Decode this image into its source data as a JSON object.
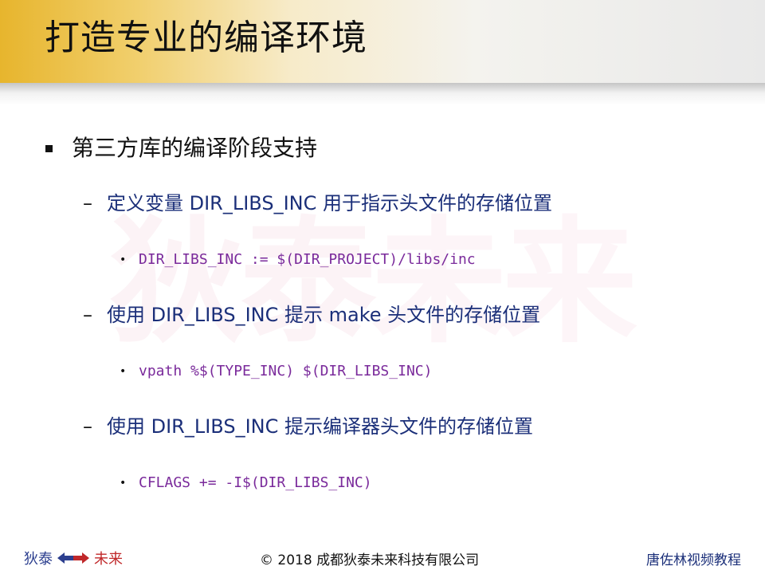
{
  "slide": {
    "title": "打造专业的编译环境"
  },
  "watermark": {
    "part1": "狄泰",
    "part2": "未来"
  },
  "content": {
    "heading": "第三方库的编译阶段支持",
    "items": [
      {
        "text": "定义变量 DIR_LIBS_INC 用于指示头文件的存储位置",
        "code": "DIR_LIBS_INC := $(DIR_PROJECT)/libs/inc"
      },
      {
        "text": "使用 DIR_LIBS_INC 提示 make 头文件的存储位置",
        "code": "vpath %$(TYPE_INC) $(DIR_LIBS_INC)"
      },
      {
        "text": "使用 DIR_LIBS_INC 提示编译器头文件的存储位置",
        "code": "CFLAGS += -I$(DIR_LIBS_INC)"
      }
    ],
    "dash_glyph": "–",
    "dot_glyph": "•"
  },
  "footer": {
    "logo_left": "狄泰",
    "logo_right": "未来",
    "copyright": "© 2018 成都狄泰未来科技有限公司",
    "author": "唐佐林视频教程"
  },
  "colors": {
    "accent_gold": "#e7b52d",
    "text_blue": "#1b2f79",
    "code_purple": "#7a2a9b",
    "arrow_blue": "#2c3f8f",
    "arrow_red": "#c0282a"
  },
  "icons": {
    "bullet": "square-bullet-icon",
    "arrows": "double-arrow-icon"
  }
}
